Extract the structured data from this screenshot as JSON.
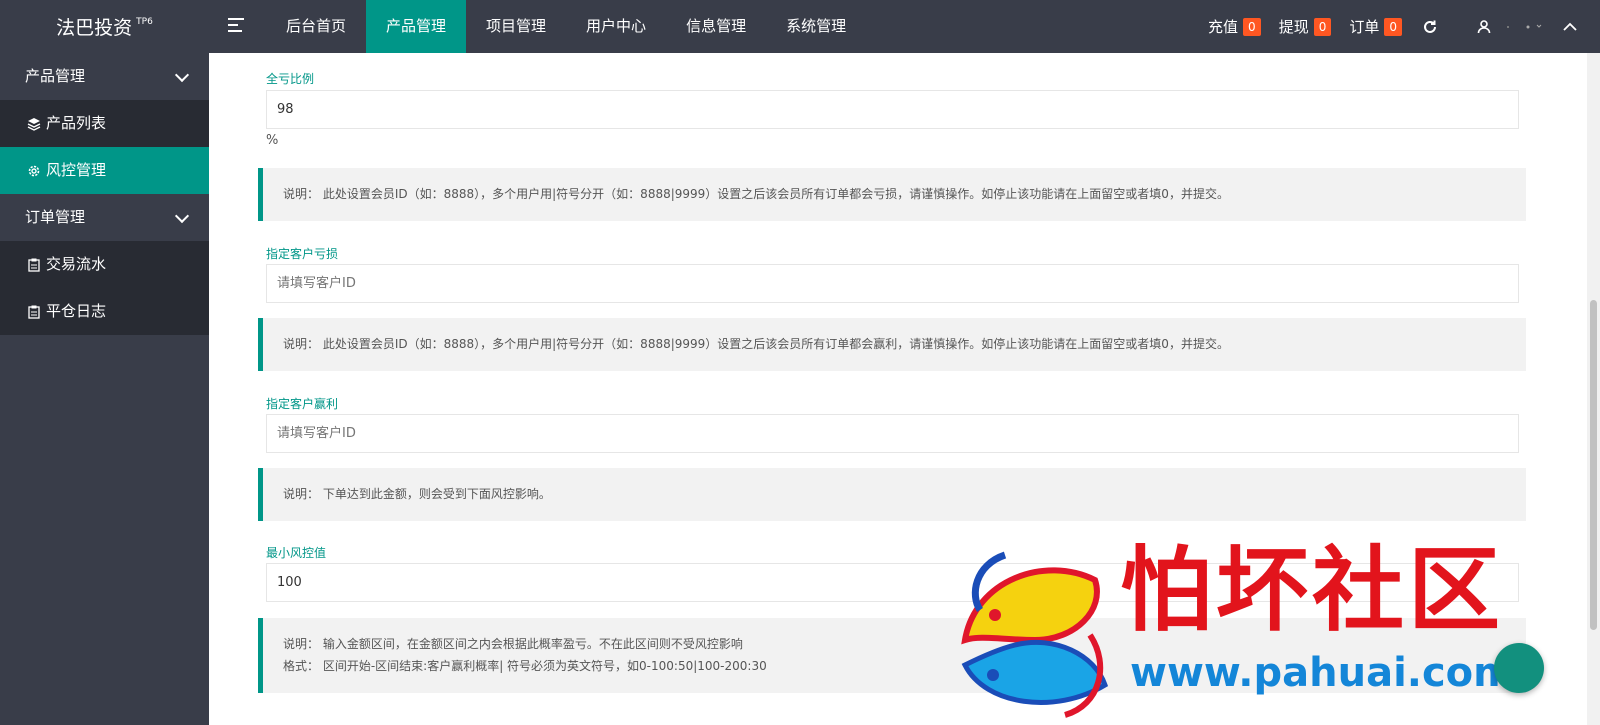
{
  "app": {
    "logo": "法巴投资",
    "logo_sup": "TP6"
  },
  "topnav": [
    {
      "label": "后台首页",
      "active": false
    },
    {
      "label": "产品管理",
      "active": true
    },
    {
      "label": "项目管理",
      "active": false
    },
    {
      "label": "用户中心",
      "active": false
    },
    {
      "label": "信息管理",
      "active": false
    },
    {
      "label": "系统管理",
      "active": false
    }
  ],
  "tools": {
    "recharge": {
      "label": "充值",
      "count": "0"
    },
    "withdraw": {
      "label": "提现",
      "count": "0"
    },
    "orders": {
      "label": "订单",
      "count": "0"
    }
  },
  "sidebar": {
    "group1": "产品管理",
    "items1": [
      {
        "label": "产品列表",
        "icon": "layers-icon"
      },
      {
        "label": "风控管理",
        "icon": "gear-icon",
        "active": true
      }
    ],
    "group2": "订单管理",
    "items2": [
      {
        "label": "交易流水",
        "icon": "clipboard-icon"
      },
      {
        "label": "平仓日志",
        "icon": "clipboard-icon"
      }
    ]
  },
  "form": {
    "loss_ratio": {
      "label": "全亏比例",
      "value": "98",
      "unit": "%"
    },
    "note1": "说明： 此处设置会员ID（如：8888），多个用户用|符号分开（如：8888|9999）设置之后该会员所有订单都会亏损，请谨慎操作。如停止该功能请在上面留空或者填0，并提交。",
    "loss_users": {
      "label": "指定客户亏损",
      "placeholder": "请填写客户ID"
    },
    "note2": "说明： 此处设置会员ID（如：8888），多个用户用|符号分开（如：8888|9999）设置之后该会员所有订单都会赢利，请谨慎操作。如停止该功能请在上面留空或者填0，并提交。",
    "win_users": {
      "label": "指定客户赢利",
      "placeholder": "请填写客户ID"
    },
    "note3": "说明： 下单达到此金额，则会受到下面风控影响。",
    "min_risk": {
      "label": "最小风控值",
      "value": "100"
    },
    "note4_line1": "说明： 输入金额区间，在金额区间之内会根据此概率盈亏。不在此区间则不受风控影响",
    "note4_line2": "格式： 区间开始-区间结束:客户赢利概率|        符号必须为英文符号，如0-100:50|100-200:30"
  },
  "watermark": {
    "text": "怕坏社区",
    "url": "www.pahuai.com"
  },
  "colors": {
    "accent": "#009688",
    "topbar": "#393D49",
    "badge": "#FF5722",
    "label": "#009688"
  }
}
